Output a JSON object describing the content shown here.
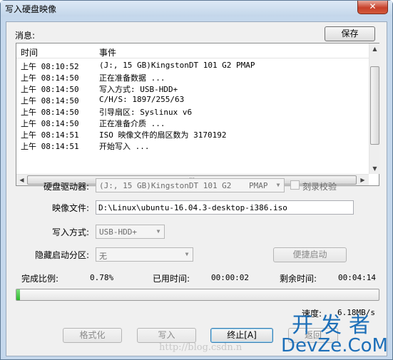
{
  "window": {
    "title": "写入硬盘映像",
    "close_glyph": "✕"
  },
  "messages": {
    "label": "消息:",
    "save_button": "保存",
    "columns": {
      "time": "时间",
      "event": "事件"
    },
    "rows": [
      {
        "time": "上午 08:10:52",
        "event": "(J:, 15 GB)KingstonDT 101 G2        PMAP"
      },
      {
        "time": "上午 08:14:50",
        "event": "正在准备数据 ..."
      },
      {
        "time": "上午 08:14:50",
        "event": "写入方式: USB-HDD+"
      },
      {
        "time": "上午 08:14:50",
        "event": "C/H/S: 1897/255/63"
      },
      {
        "time": "上午 08:14:50",
        "event": "引导扇区: Syslinux v6"
      },
      {
        "time": "上午 08:14:50",
        "event": "正在准备介质 ..."
      },
      {
        "time": "上午 08:14:51",
        "event": "ISO 映像文件的扇区数为 3170192"
      },
      {
        "time": "上午 08:14:51",
        "event": "开始写入 ..."
      }
    ]
  },
  "form": {
    "drive_label": "硬盘驱动器:",
    "drive_value": "(J:, 15 GB)KingstonDT 101 G2",
    "drive_suffix": "PMAP",
    "verify_label": "刻录校验",
    "image_label": "映像文件:",
    "image_value": "D:\\Linux\\ubuntu-16.04.3-desktop-i386.iso",
    "write_mode_label": "写入方式:",
    "write_mode_value": "USB-HDD+",
    "hidden_partition_label": "隐藏启动分区:",
    "hidden_partition_value": "无",
    "quick_boot_button": "便捷启动"
  },
  "status": {
    "ratio_label": "完成比例:",
    "ratio_value": "0.78%",
    "elapsed_label": "已用时间:",
    "elapsed_value": "00:00:02",
    "remaining_label": "剩余时间:",
    "remaining_value": "00:04:14",
    "progress_fraction": 0.0078,
    "speed_label": "速度:",
    "speed_value": "6.18MB/s"
  },
  "buttons": {
    "format": "格式化",
    "write": "写入",
    "abort": "终止[A]",
    "back": "返回"
  },
  "watermark": {
    "logo_top": "开发者",
    "logo_bottom": "DevZe.CoM",
    "url": "http://blog.csdn.n"
  },
  "colors": {
    "progress_fill": "#2cb82c",
    "watermark": "#1d6fb8"
  }
}
